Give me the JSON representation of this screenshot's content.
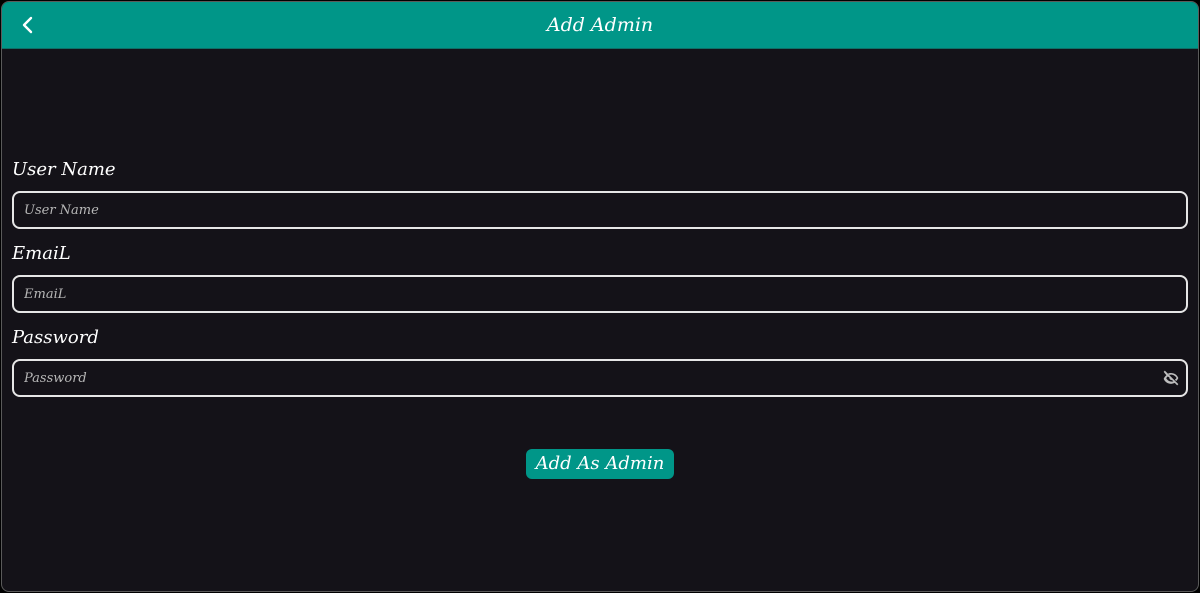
{
  "app_bar": {
    "title": "Add Admin",
    "back_icon": "chevron-left-icon",
    "color": "#009688"
  },
  "form": {
    "user_name": {
      "label": "User Name",
      "placeholder": "User Name",
      "value": ""
    },
    "email": {
      "label": "EmaiL",
      "placeholder": "EmaiL",
      "value": ""
    },
    "password": {
      "label": "Password",
      "placeholder": "Password",
      "value": "",
      "toggle_icon": "eye-off-icon"
    }
  },
  "submit": {
    "label": "Add As Admin"
  },
  "colors": {
    "background": "#141218",
    "accent": "#009688",
    "field_border": "#e6e6e6",
    "text": "#ffffff"
  }
}
